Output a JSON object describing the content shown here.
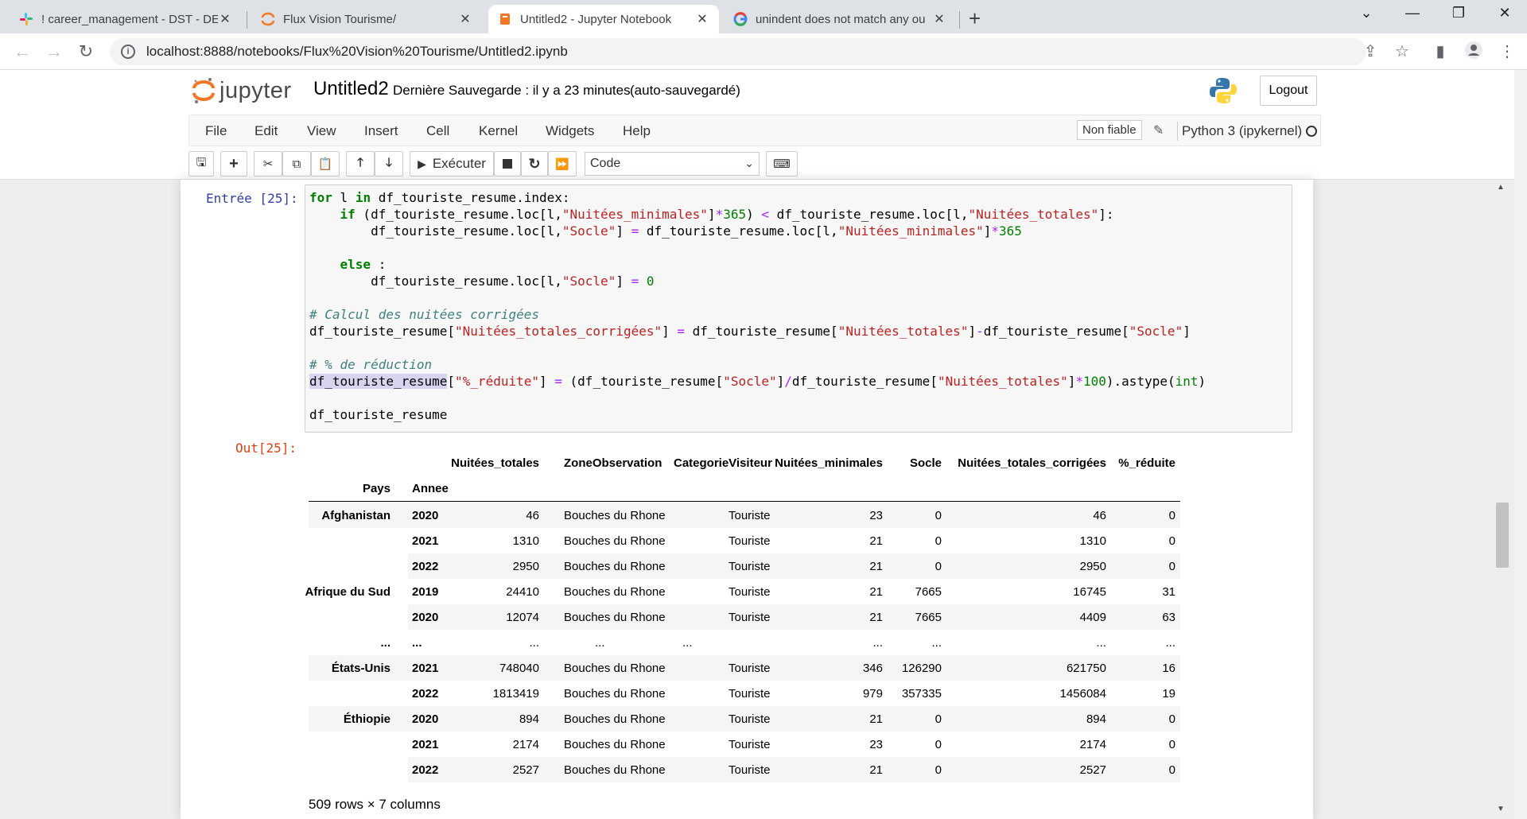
{
  "browser": {
    "tabs": [
      {
        "title": "! career_management - DST - DE",
        "icon": "slack-icon"
      },
      {
        "title": "Flux Vision Tourisme/",
        "icon": "jupyter-icon"
      },
      {
        "title": "Untitled2 - Jupyter Notebook",
        "icon": "jupyter-notebook-icon"
      },
      {
        "title": "unindent does not match any ou",
        "icon": "google-icon"
      }
    ],
    "url": "localhost:8888/notebooks/Flux%20Vision%20Tourisme/Untitled2.ipynb"
  },
  "jupyter": {
    "logo_text": "jupyter",
    "notebook_title": "Untitled2",
    "save_status": "Dernière Sauvegarde : il y a 23 minutes",
    "autosave": "(auto-sauvegardé)",
    "logout_label": "Logout",
    "menu": [
      "File",
      "Edit",
      "View",
      "Insert",
      "Cell",
      "Kernel",
      "Widgets",
      "Help"
    ],
    "trusted_label": "Non fiable",
    "kernel_name": "Python 3 (ipykernel)",
    "run_label": "Exécuter",
    "cell_type": "Code"
  },
  "cell": {
    "in_prompt": "Entrée [25]:",
    "out_prompt": "Out[25]:",
    "code_lines": [
      "for l in df_touriste_resume.index:",
      "    if (df_touriste_resume.loc[l,\"Nuitées_minimales\"]*365) < df_touriste_resume.loc[l,\"Nuitées_totales\"]:",
      "        df_touriste_resume.loc[l,\"Socle\"] = df_touriste_resume.loc[l,\"Nuitées_minimales\"]*365",
      "",
      "    else :",
      "        df_touriste_resume.loc[l,\"Socle\"] = 0",
      "",
      "# Calcul des nuitées corrigées",
      "df_touriste_resume[\"Nuitées_totales_corrigées\"] = df_touriste_resume[\"Nuitées_totales\"]-df_touriste_resume[\"Socle\"]",
      "",
      "# % de réduction",
      "df_touriste_resume[\"%_réduite\"] = (df_touriste_resume[\"Socle\"]/df_touriste_resume[\"Nuitées_totales\"]*100).astype(int)",
      "",
      "df_touriste_resume"
    ]
  },
  "dataframe": {
    "columns": [
      "Nuitées_totales",
      "ZoneObservation",
      "CategorieVisiteur",
      "Nuitées_minimales",
      "Socle",
      "Nuitées_totales_corrigées",
      "%_réduite"
    ],
    "index_names": [
      "Pays",
      "Annee"
    ],
    "rows": [
      {
        "pays": "Afghanistan",
        "annee": "2020",
        "vals": [
          "46",
          "Bouches du Rhone",
          "Touriste",
          "23",
          "0",
          "46",
          "0"
        ]
      },
      {
        "pays": "",
        "annee": "2021",
        "vals": [
          "1310",
          "Bouches du Rhone",
          "Touriste",
          "21",
          "0",
          "1310",
          "0"
        ]
      },
      {
        "pays": "",
        "annee": "2022",
        "vals": [
          "2950",
          "Bouches du Rhone",
          "Touriste",
          "21",
          "0",
          "2950",
          "0"
        ]
      },
      {
        "pays": "Afrique du Sud",
        "annee": "2019",
        "vals": [
          "24410",
          "Bouches du Rhone",
          "Touriste",
          "21",
          "7665",
          "16745",
          "31"
        ]
      },
      {
        "pays": "",
        "annee": "2020",
        "vals": [
          "12074",
          "Bouches du Rhone",
          "Touriste",
          "21",
          "7665",
          "4409",
          "63"
        ]
      },
      {
        "pays": "...",
        "annee": "...",
        "vals": [
          "...",
          "...",
          "...",
          "...",
          "...",
          "...",
          "..."
        ]
      },
      {
        "pays": "États-Unis",
        "annee": "2021",
        "vals": [
          "748040",
          "Bouches du Rhone",
          "Touriste",
          "346",
          "126290",
          "621750",
          "16"
        ]
      },
      {
        "pays": "",
        "annee": "2022",
        "vals": [
          "1813419",
          "Bouches du Rhone",
          "Touriste",
          "979",
          "357335",
          "1456084",
          "19"
        ]
      },
      {
        "pays": "Éthiopie",
        "annee": "2020",
        "vals": [
          "894",
          "Bouches du Rhone",
          "Touriste",
          "21",
          "0",
          "894",
          "0"
        ]
      },
      {
        "pays": "",
        "annee": "2021",
        "vals": [
          "2174",
          "Bouches du Rhone",
          "Touriste",
          "23",
          "0",
          "2174",
          "0"
        ]
      },
      {
        "pays": "",
        "annee": "2022",
        "vals": [
          "2527",
          "Bouches du Rhone",
          "Touriste",
          "21",
          "0",
          "2527",
          "0"
        ]
      }
    ],
    "shape_text": "509 rows × 7 columns"
  }
}
